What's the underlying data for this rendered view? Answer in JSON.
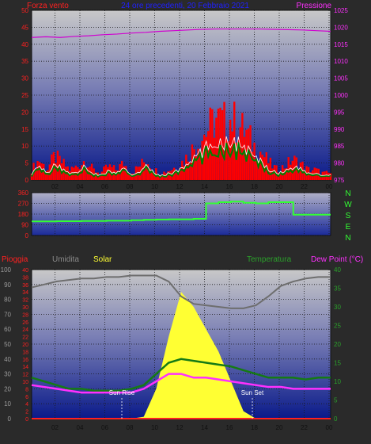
{
  "colors": {
    "background": "#2a2a2a",
    "panel_top": "#c8c8c8",
    "panel_bottom": "#0a1a8a",
    "wind": "#ff0000",
    "wind_avg": "#008000",
    "wind_light": "#ffffff",
    "pressure": "#d000d0",
    "direction": "#33ff33",
    "rain": "#ff2020",
    "humidity": "#6e6e6e",
    "solar": "#ffff33",
    "temperature": "#157a15",
    "dewpoint": "#ff30ff",
    "grid": "#1a1a1a"
  },
  "header": {
    "wind_label": "Forza vento",
    "title": "24 ore precedenti, 20 Febbraio 2021",
    "pressure_label": "Pressione"
  },
  "compass": [
    "N",
    "W",
    "S",
    "E",
    "N"
  ],
  "sun": {
    "rise": "Sun Rise",
    "set": "Sun Set"
  },
  "chart_data": [
    {
      "type": "line",
      "name": "wind-pressure",
      "x_ticks": [
        "02",
        "04",
        "06",
        "08",
        "10",
        "12",
        "14",
        "16",
        "18",
        "20",
        "22",
        "00"
      ],
      "y_left": {
        "label": "Forza vento",
        "ticks": [
          0,
          5,
          10,
          15,
          20,
          25,
          30,
          35,
          40,
          45,
          50
        ],
        "ylim": [
          0,
          50
        ]
      },
      "y_right": {
        "label": "Pressione",
        "ticks": [
          975,
          980,
          985,
          990,
          995,
          1000,
          1005,
          1010,
          1015,
          1020,
          1025
        ],
        "ylim": [
          975,
          1025
        ]
      },
      "series": [
        {
          "name": "Forza vento",
          "axis": "left",
          "values": [
            3,
            6,
            3,
            7,
            5,
            3,
            4,
            6,
            3,
            2,
            4,
            3,
            5,
            2,
            4,
            6,
            3,
            2,
            3,
            4,
            6,
            9,
            12,
            15,
            18,
            17,
            18,
            16,
            14,
            10,
            8,
            5,
            3,
            4,
            6,
            5,
            3,
            3,
            2,
            2
          ]
        },
        {
          "name": "Pressione",
          "axis": "right",
          "values": [
            1017,
            1017.2,
            1017,
            1017.3,
            1017.5,
            1017.8,
            1018,
            1018.3,
            1018.5,
            1018.8,
            1019,
            1019.2,
            1019.4,
            1019.5,
            1019.5,
            1019.5,
            1019.5,
            1019.4,
            1019.3,
            1019.2,
            1019,
            1018.8
          ]
        }
      ]
    },
    {
      "type": "line",
      "name": "wind-direction",
      "y_ticks": [
        0,
        90,
        180,
        270,
        360
      ],
      "ylim": [
        0,
        360
      ],
      "series": [
        {
          "name": "Direzione",
          "values": [
            118,
            118,
            120,
            120,
            122,
            122,
            124,
            124,
            128,
            132,
            134,
            136,
            136,
            140,
            270,
            280,
            285,
            275,
            270,
            280,
            280,
            175,
            175,
            175
          ]
        }
      ]
    },
    {
      "type": "line",
      "name": "temp-hum-solar",
      "x_ticks": [
        "02",
        "04",
        "06",
        "08",
        "10",
        "12",
        "14",
        "16",
        "18",
        "20",
        "22",
        "00"
      ],
      "legend": [
        "Pioggia",
        "Umidita",
        "Solar",
        "Temperatura",
        "Dew Point (°C)"
      ],
      "y_hum": {
        "ticks": [
          0,
          10,
          20,
          30,
          40,
          50,
          60,
          70,
          80,
          90,
          100
        ],
        "ylim": [
          0,
          100
        ]
      },
      "y_rain": {
        "ticks": [
          0,
          2,
          4,
          6,
          8,
          10,
          12,
          14,
          16,
          18,
          20,
          22,
          24,
          26,
          28,
          30,
          32,
          34,
          36,
          38,
          40
        ],
        "ylim": [
          0,
          40
        ]
      },
      "y_temp": {
        "ticks": [
          0,
          5,
          10,
          15,
          20,
          25,
          30,
          35,
          40
        ],
        "ylim": [
          0,
          40
        ]
      },
      "series": [
        {
          "name": "Umidita",
          "values": [
            88,
            90,
            92,
            93,
            94,
            94,
            95,
            95,
            96,
            96,
            96,
            92,
            82,
            77,
            76,
            75,
            74,
            74,
            76,
            82,
            89,
            92,
            94,
            95,
            95
          ]
        },
        {
          "name": "Temperatura",
          "values": [
            11,
            10,
            9,
            8,
            8,
            7.5,
            7.5,
            7.5,
            8,
            9,
            12,
            15,
            16,
            15.5,
            15,
            14.5,
            14,
            13,
            12,
            11,
            11,
            11,
            10.5,
            11,
            11
          ]
        },
        {
          "name": "Dew Point (°C)",
          "values": [
            9,
            8.5,
            8,
            7.5,
            7,
            7,
            7,
            7,
            7,
            8,
            10,
            12,
            12,
            11,
            11,
            10.5,
            10,
            9.5,
            9,
            8.5,
            8.5,
            8,
            8,
            8,
            8
          ]
        },
        {
          "name": "Solar",
          "values": [
            0,
            0,
            0,
            0,
            0,
            0,
            0,
            0,
            0,
            0.5,
            8,
            22,
            34,
            30,
            24,
            18,
            10,
            2,
            0,
            0,
            0,
            0,
            0,
            0,
            0
          ]
        },
        {
          "name": "Pioggia",
          "values": [
            0,
            0,
            0,
            0,
            0,
            0,
            0,
            0,
            0,
            0,
            0,
            0,
            0,
            0,
            0,
            0,
            0,
            0,
            0,
            0,
            0,
            0,
            0,
            0,
            0
          ]
        }
      ]
    }
  ]
}
